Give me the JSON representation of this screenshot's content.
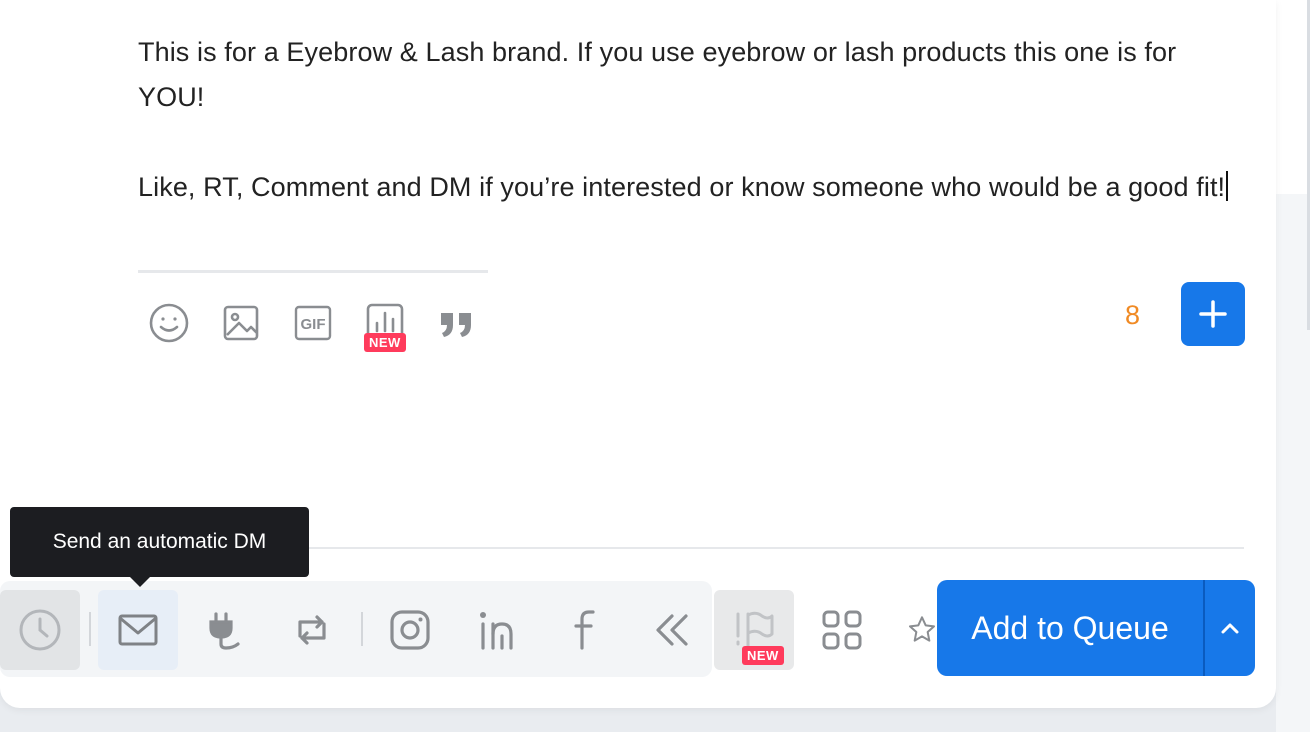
{
  "post": {
    "paragraph_1": "This is for a Eyebrow & Lash brand. If you use eyebrow or lash products this one is for YOU!",
    "paragraph_2": "Like, RT, Comment and DM if you’re interested or know someone who would be a good fit!"
  },
  "composer_toolbar": {
    "tools": [
      "emoji-icon",
      "image-icon",
      "gif-icon",
      "poll-icon",
      "quote-icon"
    ],
    "poll_badge": "NEW",
    "char_count": "8"
  },
  "tooltip": {
    "text": "Send an automatic DM"
  },
  "bottom_bar": {
    "icons": [
      "clock-icon",
      "mail-icon",
      "plug-icon",
      "retweet-icon",
      "instagram-icon",
      "linkedin-icon",
      "facebook-icon",
      "chevrons-left-icon",
      "flag-icon",
      "grid-icon",
      "star-icon"
    ],
    "flag_badge": "NEW",
    "add_to_queue_label": "Add to Queue"
  },
  "colors": {
    "primary": "#1778e9",
    "badge": "#ff3b5c",
    "char_count": "#f08a24",
    "tooltip_bg": "#1c1d21"
  }
}
